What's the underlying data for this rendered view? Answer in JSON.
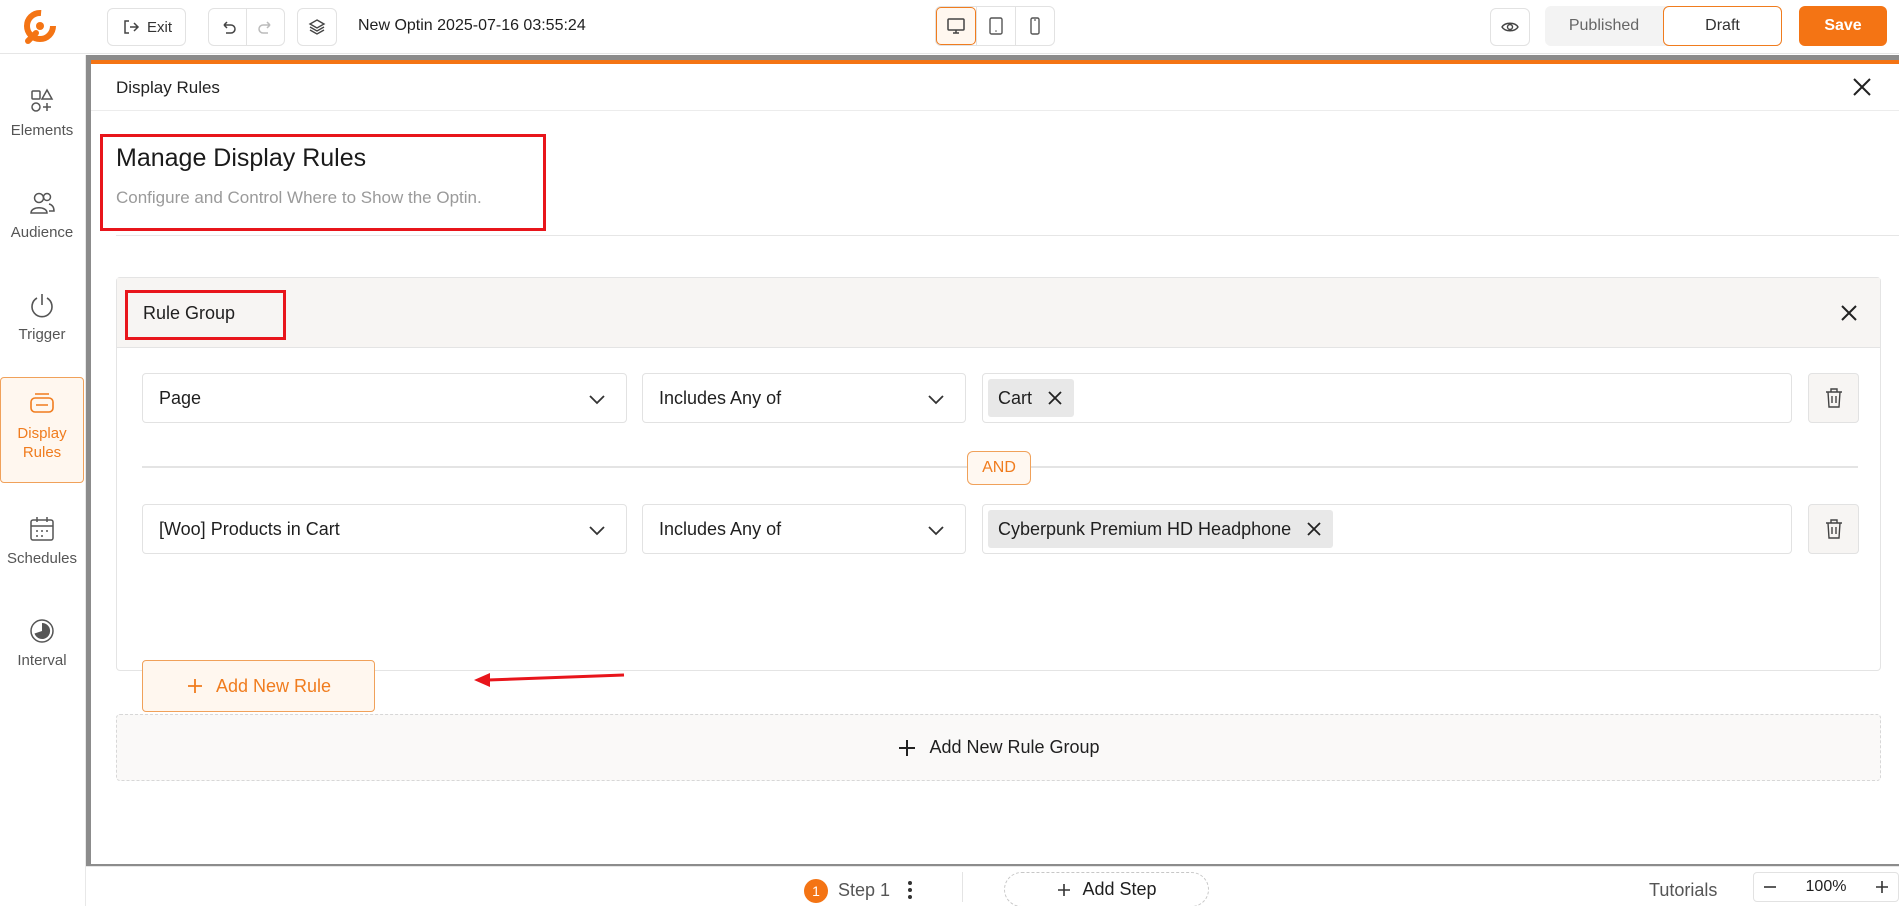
{
  "topbar": {
    "exit_label": "Exit",
    "optin_title": "New Optin 2025-07-16 03:55:24",
    "status_published": "Published",
    "status_draft": "Draft",
    "save_label": "Save",
    "active_device": "desktop"
  },
  "sidebar": {
    "items": [
      {
        "label": "Elements",
        "icon": "elements-icon"
      },
      {
        "label": "Audience",
        "icon": "audience-icon"
      },
      {
        "label": "Trigger",
        "icon": "power-icon"
      },
      {
        "label": "Display Rules",
        "icon": "display-rules-icon",
        "active": true
      },
      {
        "label": "Schedules",
        "icon": "calendar-icon"
      },
      {
        "label": "Interval",
        "icon": "interval-icon"
      }
    ]
  },
  "modal": {
    "title": "Display Rules",
    "heading": "Manage Display Rules",
    "subheading": "Configure and Control Where to Show the Optin."
  },
  "rule_group": {
    "title": "Rule Group",
    "and_label": "AND",
    "rules": [
      {
        "field": "Page",
        "operator": "Includes Any of",
        "values": [
          "Cart"
        ]
      },
      {
        "field": "[Woo] Products in Cart",
        "operator": "Includes Any of",
        "values": [
          "Cyberpunk Premium HD Headphone"
        ]
      }
    ],
    "add_rule_label": "Add New Rule"
  },
  "add_group_label": "Add New Rule Group",
  "bottombar": {
    "step_number": "1",
    "step_label": "Step 1",
    "add_step_label": "Add Step",
    "tutorials_label": "Tutorials",
    "zoom": "100%"
  },
  "colors": {
    "accent": "#f47414",
    "annotation": "#e8151b"
  }
}
